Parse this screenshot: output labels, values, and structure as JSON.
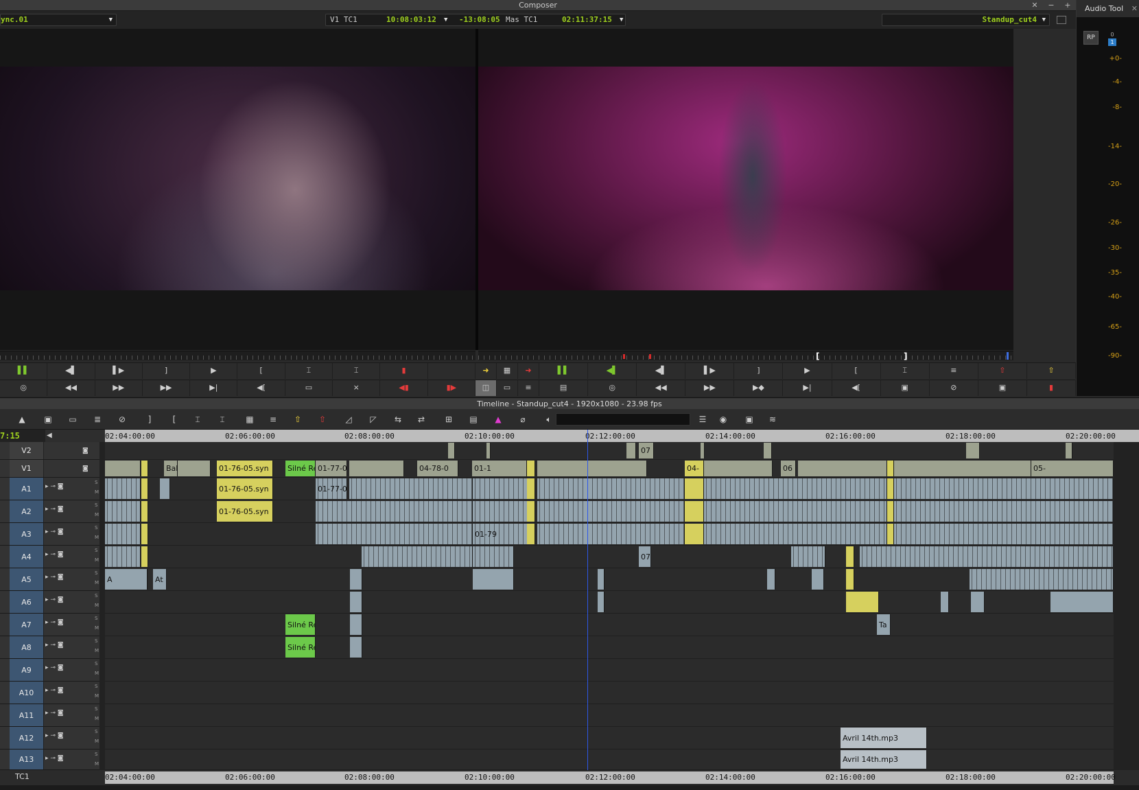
{
  "window": {
    "title": "Composer",
    "controls": [
      "✕",
      "−",
      "+"
    ]
  },
  "composer": {
    "source_clip": "ync.01",
    "tc_display": {
      "label1": "V1 TC1",
      "value1": "10:08:03:12",
      "value2": "-13:08:05",
      "label2": "Mas TC1",
      "value3": "02:11:37:15"
    },
    "record_sequence": "Standup_cut4"
  },
  "audio_tool": {
    "title": "Audio Tool",
    "rp_label": "RP",
    "channel_top": "0",
    "channel_bottom": "1",
    "scale": [
      "+0-",
      "-4-",
      "-8-",
      "-14-",
      "-20-",
      "-26-",
      "-30-",
      "-35-",
      "-40-",
      "-65-",
      "-90-"
    ]
  },
  "timeline": {
    "title": "Timeline - Standup_cut4 - 1920x1080 - 23.98 fps",
    "position_tc": "7:15",
    "ruler_labels": [
      "02:04:00:00",
      "02:06:00:00",
      "02:08:00:00",
      "02:10:00:00",
      "02:12:00:00",
      "02:14:00:00",
      "02:16:00:00",
      "02:18:00:00",
      "02:20:00:00"
    ],
    "tc_track_label": "TC1",
    "tracks": [
      {
        "name": "V2",
        "type": "video"
      },
      {
        "name": "V1",
        "type": "video"
      },
      {
        "name": "A1",
        "type": "audio"
      },
      {
        "name": "A2",
        "type": "audio"
      },
      {
        "name": "A3",
        "type": "audio"
      },
      {
        "name": "A4",
        "type": "audio"
      },
      {
        "name": "A5",
        "type": "audio"
      },
      {
        "name": "A6",
        "type": "audio"
      },
      {
        "name": "A7",
        "type": "audio"
      },
      {
        "name": "A8",
        "type": "audio"
      },
      {
        "name": "A9",
        "type": "audio"
      },
      {
        "name": "A10",
        "type": "audio"
      },
      {
        "name": "A11",
        "type": "audio"
      },
      {
        "name": "A12",
        "type": "audio"
      },
      {
        "name": "A13",
        "type": "audio"
      }
    ],
    "clip_labels": {
      "v2_07": "07",
      "v1_bal": "Bal",
      "v1_0176": "01-76-05.syn",
      "v1_silne": "Silné Re",
      "v1_0177": "01-77-0",
      "v1_0478": "04-78-0",
      "v1_01": "01-1",
      "v1_04": "04-",
      "v1_06": "06",
      "v1_05": "05-",
      "a1_0176": "01-76-05.syn",
      "a2_0176": "01-76-05.syn",
      "a1_0177": "01-77-0",
      "a1_0179": "01-79",
      "a4_07": "07",
      "a5_a": "A",
      "a5_at": "At",
      "a7_silne": "Silné Re",
      "a8_silne": "Silné Re",
      "a7_ta": "Ta",
      "a12_avril": "Avril 14th.mp3",
      "a13_avril": "Avril 14th.mp3"
    }
  },
  "colors": {
    "accent_green": "#9fd11e",
    "audio_clip": "#94a4ae",
    "sync_clip": "#d6d05e",
    "playhead": "#2d57e8"
  }
}
